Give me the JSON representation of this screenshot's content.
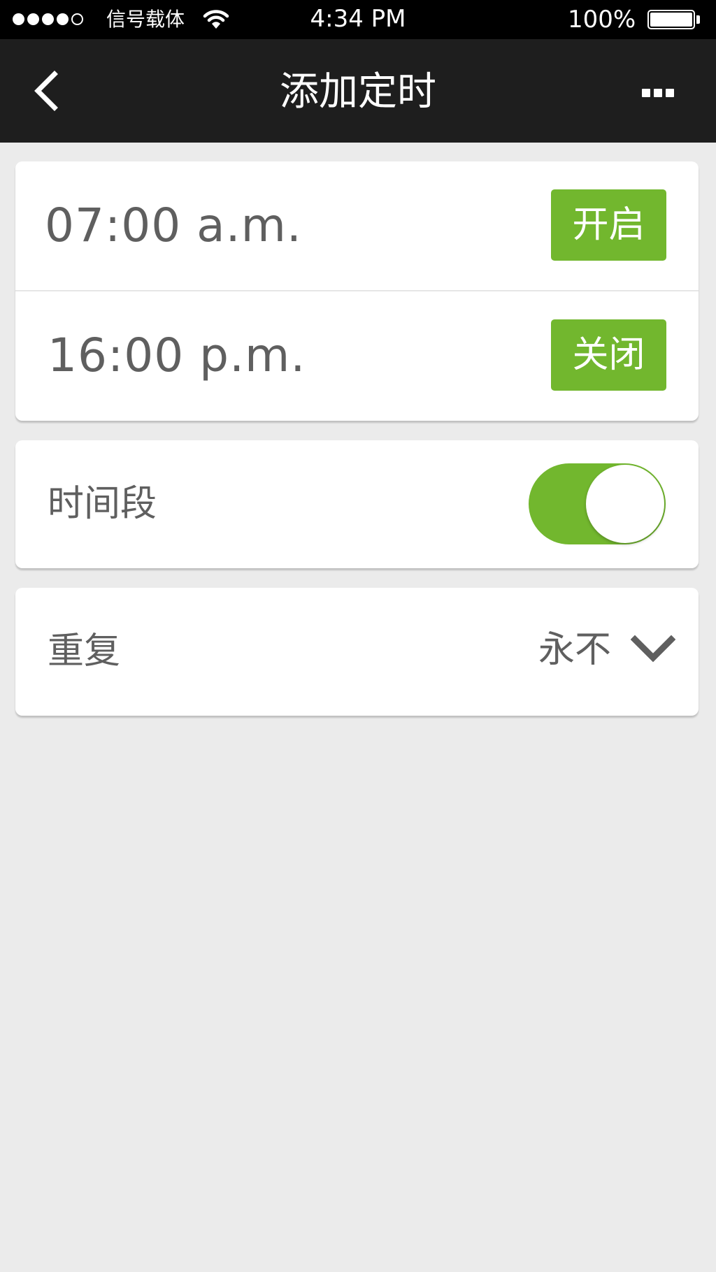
{
  "status_bar": {
    "carrier": "信号载体",
    "time": "4:34 PM",
    "battery_percent": "100%",
    "signal_strength": 4,
    "signal_max": 5,
    "battery_level": 1.0
  },
  "nav": {
    "title": "添加定时",
    "back_icon": "chevron-left-icon",
    "more_icon": "more-icon"
  },
  "schedule": {
    "entries": [
      {
        "time": "07:00 a.m.",
        "action": "开启"
      },
      {
        "time": "16:00 p.m.",
        "action": "关闭"
      }
    ]
  },
  "period": {
    "label": "时间段",
    "enabled": true
  },
  "repeat": {
    "label": "重复",
    "value": "永不",
    "icon": "chevron-down-icon"
  },
  "colors": {
    "accent": "#72b72e",
    "nav_background": "#1e1e1e",
    "page_background": "#ebebeb",
    "text": "#5f5f5f"
  }
}
